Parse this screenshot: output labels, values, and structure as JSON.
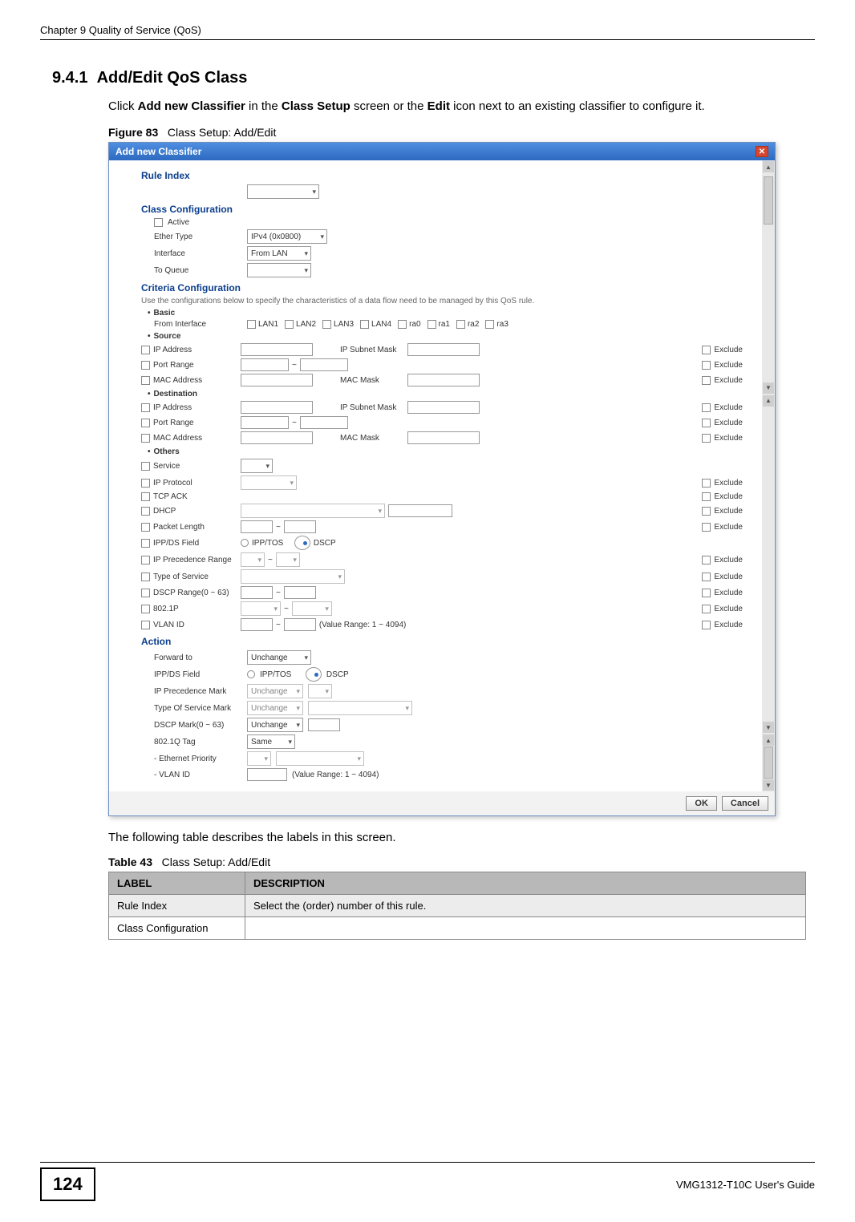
{
  "header": {
    "chapter": "Chapter 9 Quality of Service (QoS)"
  },
  "section": {
    "number": "9.4.1",
    "title": "Add/Edit QoS Class"
  },
  "intro": {
    "t1": "Click ",
    "b1": "Add new Classifier",
    "t2": " in the ",
    "b2": "Class Setup",
    "t3": " screen or the ",
    "b3": "Edit",
    "t4": " icon next to an existing classifier to configure it."
  },
  "figure": {
    "label": "Figure 83",
    "caption": "Class Setup: Add/Edit"
  },
  "dialog": {
    "title": "Add new Classifier",
    "rule_index": "Rule Index",
    "class_config": "Class Configuration",
    "active": "Active",
    "ether_type": "Ether Type",
    "ether_type_val": "IPv4 (0x0800)",
    "interface": "Interface",
    "interface_val": "From LAN",
    "to_queue": "To Queue",
    "criteria_config": "Criteria Configuration",
    "criteria_hint": "Use the configurations below to specify the characteristics of a data flow need to be managed by this QoS rule.",
    "basic": "Basic",
    "from_interface": "From Interface",
    "lans": [
      "LAN1",
      "LAN2",
      "LAN3",
      "LAN4",
      "ra0",
      "ra1",
      "ra2",
      "ra3"
    ],
    "source": "Source",
    "destination": "Destination",
    "ip_address": "IP Address",
    "ip_subnet_mask": "IP Subnet Mask",
    "port_range": "Port Range",
    "mac_address": "MAC Address",
    "mac_mask": "MAC Mask",
    "exclude": "Exclude",
    "others": "Others",
    "service": "Service",
    "ip_protocol": "IP Protocol",
    "tcp_ack": "TCP ACK",
    "dhcp": "DHCP",
    "packet_length": "Packet Length",
    "ipp_ds_field": "IPP/DS Field",
    "ipp_tos": "IPP/TOS",
    "dscp": "DSCP",
    "ip_precedence_range": "IP Precedence Range",
    "type_of_service": "Type of Service",
    "dscp_range": "DSCP Range(0 ~ 63)",
    "dot1p": "802.1P",
    "vlan_id": "VLAN ID",
    "vlan_range": "(Value Range: 1 ~ 4094)",
    "action": "Action",
    "forward_to": "Forward to",
    "forward_to_val": "Unchange",
    "ipp_ds_field2": "IPP/DS Field",
    "ip_precedence_mark": "IP Precedence Mark",
    "ip_precedence_mark_val": "Unchange",
    "type_of_service_mark": "Type Of Service Mark",
    "type_of_service_mark_val": "Unchange",
    "dscp_mark": "DSCP Mark(0 ~ 63)",
    "dscp_mark_val": "Unchange",
    "dot1q_tag": "802.1Q Tag",
    "dot1q_tag_val": "Same",
    "eth_priority": "- Ethernet Priority",
    "vlan_id2": "- VLAN ID",
    "ok": "OK",
    "cancel": "Cancel",
    "tilde": "~"
  },
  "following": "The following table describes the labels in this screen.",
  "table": {
    "label": "Table 43",
    "caption": "Class Setup: Add/Edit",
    "th_label": "LABEL",
    "th_desc": "DESCRIPTION",
    "rows": [
      {
        "label": "Rule Index",
        "desc": "Select the (order) number of this rule."
      },
      {
        "label": "Class Configuration",
        "desc": ""
      }
    ]
  },
  "footer": {
    "page": "124",
    "guide": "VMG1312-T10C User's Guide"
  }
}
